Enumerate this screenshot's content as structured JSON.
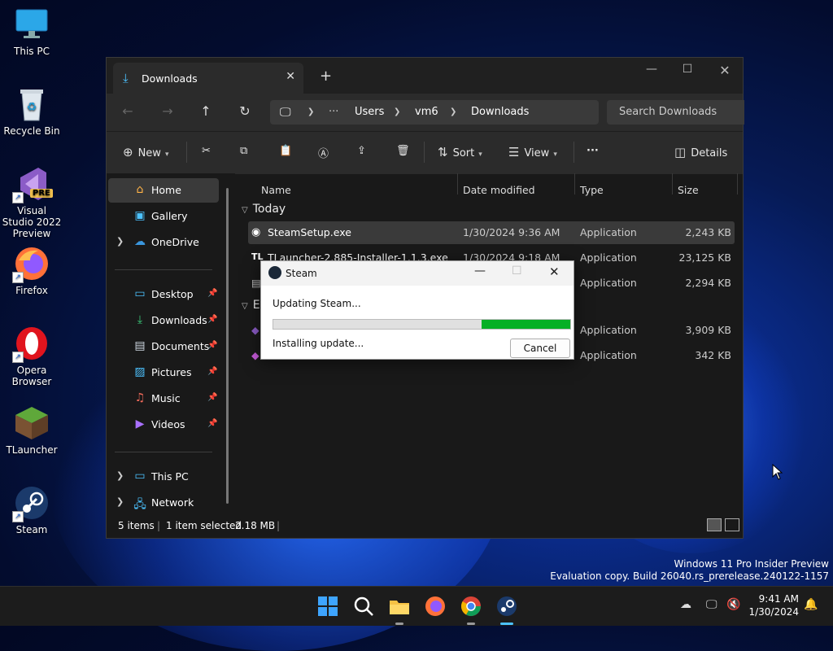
{
  "desktop": {
    "icons": [
      {
        "label": "This PC"
      },
      {
        "label": "Recycle Bin"
      },
      {
        "label": "Visual Studio 2022 Preview",
        "badge": "PRE"
      },
      {
        "label": "Firefox"
      },
      {
        "label": "Opera Browser"
      },
      {
        "label": "TLauncher"
      },
      {
        "label": "Steam"
      }
    ],
    "watermark": {
      "line1": "Windows 11 Pro Insider Preview",
      "line2": "Evaluation copy. Build 26040.rs_prerelease.240122-1157"
    }
  },
  "explorer": {
    "tab_title": "Downloads",
    "breadcrumb": [
      "Users",
      "vm6",
      "Downloads"
    ],
    "search_placeholder": "Search Downloads",
    "toolbar": {
      "new_label": "New",
      "sort_label": "Sort",
      "view_label": "View",
      "details_label": "Details"
    },
    "sidebar": {
      "home": "Home",
      "gallery": "Gallery",
      "onedrive": "OneDrive",
      "quick": [
        "Desktop",
        "Downloads",
        "Documents",
        "Pictures",
        "Music",
        "Videos"
      ],
      "this_pc": "This PC",
      "network": "Network"
    },
    "columns": {
      "name": "Name",
      "date": "Date modified",
      "type": "Type",
      "size": "Size"
    },
    "groups": {
      "today": "Today",
      "earlier": "E"
    },
    "files": [
      {
        "name": "SteamSetup.exe",
        "date": "1/30/2024 9:36 AM",
        "type": "Application",
        "size": "2,243 KB"
      },
      {
        "name": "TLauncher-2.885-Installer-1.1.3.exe",
        "date": "1/30/2024 9:18 AM",
        "type": "Application",
        "size": "23,125 KB"
      },
      {
        "name": "",
        "date": "",
        "type": "Application",
        "size": "2,294 KB"
      },
      {
        "name": "",
        "date": "",
        "type": "Application",
        "size": "3,909 KB"
      },
      {
        "name": "",
        "date": "",
        "type": "Application",
        "size": "342 KB"
      }
    ],
    "status": {
      "items": "5 items",
      "selected": "1 item selected",
      "size": "2.18 MB"
    }
  },
  "dialog": {
    "title": "Steam",
    "message": "Updating Steam...",
    "status": "Installing update...",
    "cancel_label": "Cancel",
    "progress_fraction": 0.3
  },
  "taskbar": {
    "time": "9:41 AM",
    "date": "1/30/2024"
  }
}
